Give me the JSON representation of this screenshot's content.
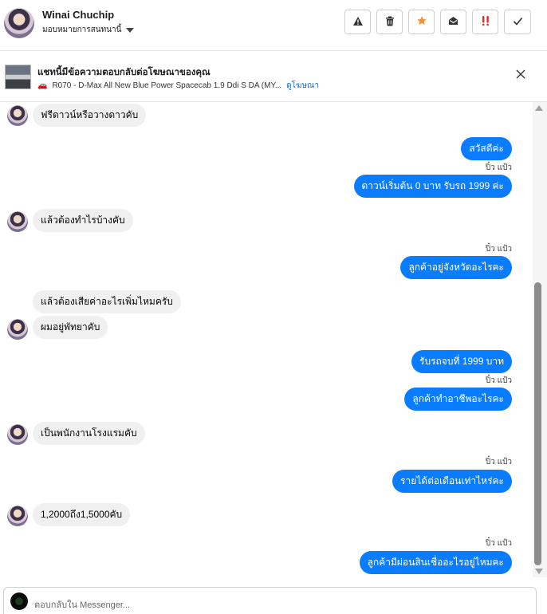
{
  "header": {
    "name": "Winai Chuchip",
    "assign_label": "มอบหมายการสนทนานี้",
    "actions": [
      {
        "icon": "warning-icon",
        "glyph": "⚠"
      },
      {
        "icon": "trash-icon",
        "glyph": "🗑"
      },
      {
        "icon": "star-icon",
        "glyph": "★"
      },
      {
        "icon": "envelope-open-icon",
        "glyph": "✉"
      },
      {
        "icon": "priority-icon",
        "glyph": "‼"
      },
      {
        "icon": "check-icon",
        "glyph": "✓"
      }
    ]
  },
  "ad": {
    "title": "แชทนี้มีข้อความตอบกลับต่อโฆษณาของคุณ",
    "car_icon": "🚗",
    "product": "R070 - D-Max All New Blue Power Spacecab 1.9 Ddi S DA (MY...",
    "link": "ดูโฆษณา"
  },
  "messages": [
    {
      "dir": "in",
      "text": "ฟรีดาวน์หรือวางดาวคับ"
    },
    {
      "dir": "out",
      "text": "สวัสดีค่ะ"
    },
    {
      "sender": "ปิ๋ว แป้ว"
    },
    {
      "dir": "out",
      "text": "ดาวน์เริ่มต้น 0 บาท รับรถ 1999 ค่ะ"
    },
    {
      "dir": "in",
      "text": "แล้วต้องทำไรบ้างคับ"
    },
    {
      "sender": "ปิ๋ว แป้ว"
    },
    {
      "dir": "out",
      "text": "ลูกค้าอยู่จังหวัดอะไรคะ"
    },
    {
      "dir": "in",
      "text": "แล้วต้องเสียค่าอะไรเพิ่มไหมครับ"
    },
    {
      "dir": "in",
      "text": "ผมอยู่พัทยาคับ"
    },
    {
      "dir": "out",
      "text": "รับรถจบที่ 1999 บาท"
    },
    {
      "sender": "ปิ๋ว แป้ว"
    },
    {
      "dir": "out",
      "text": "ลูกค้าทำอาชีพอะไรคะ"
    },
    {
      "dir": "in",
      "text": "เป็นพนักงานโรงแรมคับ"
    },
    {
      "sender": "ปิ๋ว แป้ว"
    },
    {
      "dir": "out",
      "text": "รายได้ต่อเดือนเท่าไหร่คะ"
    },
    {
      "dir": "in",
      "text": "1,2000ถึง1,5000คับ"
    },
    {
      "sender": "ปิ๋ว แป้ว"
    },
    {
      "dir": "out",
      "text": "ลูกค้ามีผ่อนสินเชื่ออะไรอยู่ไหมคะ"
    }
  ],
  "composer": {
    "placeholder": "ตอบกลับใน Messenger..."
  },
  "colors": {
    "outgoing": "#0a7cff",
    "incoming": "#f0f0f0"
  }
}
